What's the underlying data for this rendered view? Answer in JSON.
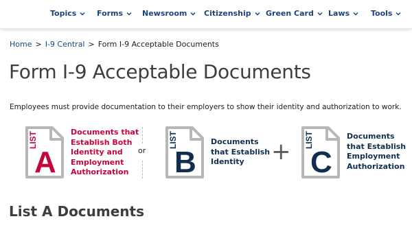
{
  "nav": {
    "items": [
      {
        "label": "Topics"
      },
      {
        "label": "Forms"
      },
      {
        "label": "Newsroom"
      },
      {
        "label": "Citizenship"
      },
      {
        "label": "Green Card"
      },
      {
        "label": "Laws"
      },
      {
        "label": "Tools"
      }
    ]
  },
  "breadcrumb": {
    "home": "Home",
    "separator": ">",
    "section": "I-9 Central",
    "current": "Form I-9 Acceptable Documents"
  },
  "page": {
    "title": "Form I-9 Acceptable Documents",
    "intro": "Employees must provide documentation to their employers to show their identity and authorization to work."
  },
  "lists": [
    {
      "word": "LIST",
      "letter": "A",
      "color": "#c5053b",
      "caption_lines": [
        "Documents that",
        "Establish Both",
        "Identity and",
        "Employment",
        "Authorization"
      ]
    },
    {
      "word": "LIST",
      "letter": "B",
      "color": "#112e51",
      "caption_lines": [
        "Documents",
        "that Establish",
        "Identity"
      ]
    },
    {
      "word": "LIST",
      "letter": "C",
      "color": "#112e51",
      "caption_lines": [
        "Documents",
        "that Establish",
        "Employment",
        "Authorization"
      ]
    }
  ],
  "connectors": {
    "or": "or",
    "plus": "+"
  },
  "section": {
    "heading": "List A Documents"
  },
  "colors": {
    "nav_link": "#1a4480",
    "list_a": "#c5053b",
    "list_bc": "#112e51",
    "icon_frame": "#b7b7b7",
    "heading_gray": "#3d3d3d"
  }
}
